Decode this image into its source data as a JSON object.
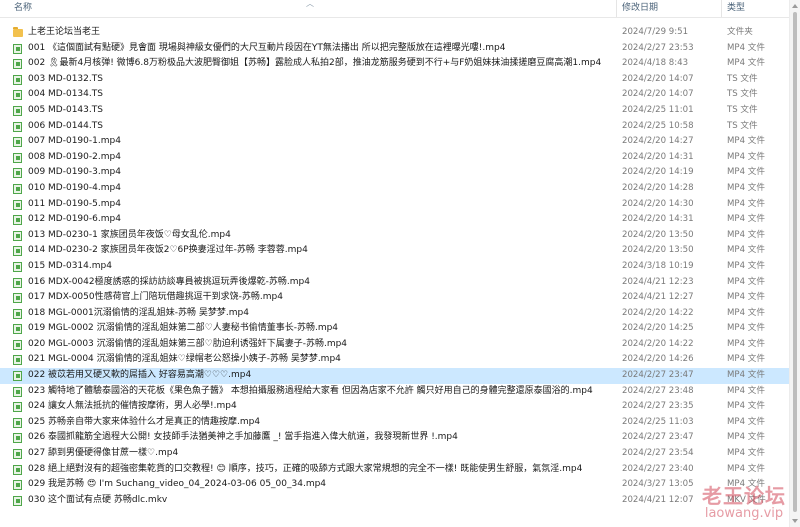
{
  "header": {
    "name_label": "名称",
    "date_label": "修改日期",
    "type_label": "类型"
  },
  "rows": [
    {
      "icon": "folder-icon",
      "name": "上老王论坛当老王",
      "date": "2024/7/29 9:51",
      "type": "文件夹"
    },
    {
      "icon": "video-file-icon",
      "name": "001 《這個面試有點硬》見會面 現場與神級女優們的大尺互動片段因在YT無法播出 所以把完整版放在這裡曝光嘍!.mp4",
      "date": "2024/2/27 23:53",
      "type": "MP4 文件"
    },
    {
      "icon": "video-file-icon",
      "name": "002 🎗最新4月核弹! 微博6.8万粉极品大波肥臀御姐【苏畅】露脸成人私拍2部，推油龙筋服务硬到不行+与F奶姐妹抹油揉搓磨豆腐高潮1.mp4",
      "date": "2024/4/18 8:43",
      "type": "MP4 文件"
    },
    {
      "icon": "video-file-icon",
      "name": "003 MD-0132.TS",
      "date": "2024/2/20 14:07",
      "type": "TS 文件"
    },
    {
      "icon": "video-file-icon",
      "name": "004 MD-0134.TS",
      "date": "2024/2/20 14:07",
      "type": "TS 文件"
    },
    {
      "icon": "video-file-icon",
      "name": "005 MD-0143.TS",
      "date": "2024/2/25 11:01",
      "type": "TS 文件"
    },
    {
      "icon": "video-file-icon",
      "name": "006 MD-0144.TS",
      "date": "2024/2/25 10:58",
      "type": "TS 文件"
    },
    {
      "icon": "video-file-icon",
      "name": "007 MD-0190-1.mp4",
      "date": "2024/2/20 14:27",
      "type": "MP4 文件"
    },
    {
      "icon": "video-file-icon",
      "name": "008 MD-0190-2.mp4",
      "date": "2024/2/20 14:31",
      "type": "MP4 文件"
    },
    {
      "icon": "video-file-icon",
      "name": "009 MD-0190-3.mp4",
      "date": "2024/2/20 14:19",
      "type": "MP4 文件"
    },
    {
      "icon": "video-file-icon",
      "name": "010 MD-0190-4.mp4",
      "date": "2024/2/20 14:28",
      "type": "MP4 文件"
    },
    {
      "icon": "video-file-icon",
      "name": "011 MD-0190-5.mp4",
      "date": "2024/2/20 14:30",
      "type": "MP4 文件"
    },
    {
      "icon": "video-file-icon",
      "name": "012 MD-0190-6.mp4",
      "date": "2024/2/20 14:31",
      "type": "MP4 文件"
    },
    {
      "icon": "video-file-icon",
      "name": "013 MD-0230-1 家族团员年夜饭♡母女乱伦.mp4",
      "date": "2024/2/20 13:50",
      "type": "MP4 文件"
    },
    {
      "icon": "video-file-icon",
      "name": "014 MD-0230-2 家族团员年夜饭2♡6P换妻淫过年-苏畅 李蓉蓉.mp4",
      "date": "2024/2/20 13:50",
      "type": "MP4 文件"
    },
    {
      "icon": "video-file-icon",
      "name": "015 MD-0314.mp4",
      "date": "2024/3/18 10:19",
      "type": "MP4 文件"
    },
    {
      "icon": "video-file-icon",
      "name": "016 MDX-0042極度誘惑的採訪訪談專員被挑逗玩弄後爆乾-苏畅.mp4",
      "date": "2024/4/21 12:23",
      "type": "MP4 文件"
    },
    {
      "icon": "video-file-icon",
      "name": "017 MDX-0050性感荷官上门陪玩借趣挑逗干到求饶-苏畅.mp4",
      "date": "2024/4/21 12:27",
      "type": "MP4 文件"
    },
    {
      "icon": "video-file-icon",
      "name": "018 MGL-0001沉溺偷情的淫乱姐妹-苏畅 吴梦梦.mp4",
      "date": "2024/2/20 14:22",
      "type": "MP4 文件"
    },
    {
      "icon": "video-file-icon",
      "name": "019 MGL-0002 沉溺偷情的淫乱姐妹第二部♡人妻秘书偷情董事长-苏畅.mp4",
      "date": "2024/2/20 14:25",
      "type": "MP4 文件"
    },
    {
      "icon": "video-file-icon",
      "name": "020 MGL-0003 沉溺偷情的淫乱姐妹第三部♡肋迫利诱强奸下属妻子-苏畅.mp4",
      "date": "2024/2/20 14:22",
      "type": "MP4 文件"
    },
    {
      "icon": "video-file-icon",
      "name": "021 MGL-0004 沉溺偷情的淫乱姐妹♡绿帽老公怒操小姨子-苏畅 吴梦梦.mp4",
      "date": "2024/2/20 14:26",
      "type": "MP4 文件"
    },
    {
      "icon": "video-file-icon",
      "name": "022 被苡若用又硬又軟的屌插入 好容易高潮♡♡♡.mp4",
      "date": "2024/2/27 23:47",
      "type": "MP4 文件",
      "selected": true
    },
    {
      "icon": "video-file-icon",
      "name": "023 觸特地了體驗泰國浴的天花板《果色魚子醬》 本想拍攝服務過程給大家看 但因為店家不允許 觸只好用自己的身體完整還原泰國浴的.mp4",
      "date": "2024/2/27 23:48",
      "type": "MP4 文件"
    },
    {
      "icon": "video-file-icon",
      "name": "024 讓女人無法抵抗的催情按摩術，男人必學!.mp4",
      "date": "2024/2/27 23:35",
      "type": "MP4 文件"
    },
    {
      "icon": "video-file-icon",
      "name": "025 苏畅亲自带大家来体验什么才是真正的情趣按摩.mp4",
      "date": "2024/2/25 11:03",
      "type": "MP4 文件"
    },
    {
      "icon": "video-file-icon",
      "name": "026 泰國抓龍筋全過程大公開! 女技師手法猶美神之手加藤鷹 _! 當手指進入偉大航道，我發現新世界 !.mp4",
      "date": "2024/2/27 23:47",
      "type": "MP4 文件"
    },
    {
      "icon": "video-file-icon",
      "name": "027 舔到男優硬得像甘蔗一樣♡.mp4",
      "date": "2024/2/27 23:54",
      "type": "MP4 文件"
    },
    {
      "icon": "video-file-icon",
      "name": "028 絕上絕對沒有的超強密集乾貨的口交教程! 😊 順序，技巧，正確的吸舔方式跟大家常規想的完全不一樣! 既能使男生舒服，氣氛淫.mp4",
      "date": "2024/2/27 23:40",
      "type": "MP4 文件"
    },
    {
      "icon": "video-file-icon",
      "name": "029 我是苏畅 😍 I'm Suchang_video_04_2024-03-06 05_00_34.mp4",
      "date": "2024/3/27 13:05",
      "type": "MP4 文件"
    },
    {
      "icon": "video-file-icon",
      "name": "030 这个面试有点硬 苏畅dlc.mkv",
      "date": "2024/4/21 12:07",
      "type": "MKV 文件"
    }
  ],
  "watermark": {
    "title": "老王论坛",
    "url": "laowang.vip"
  }
}
